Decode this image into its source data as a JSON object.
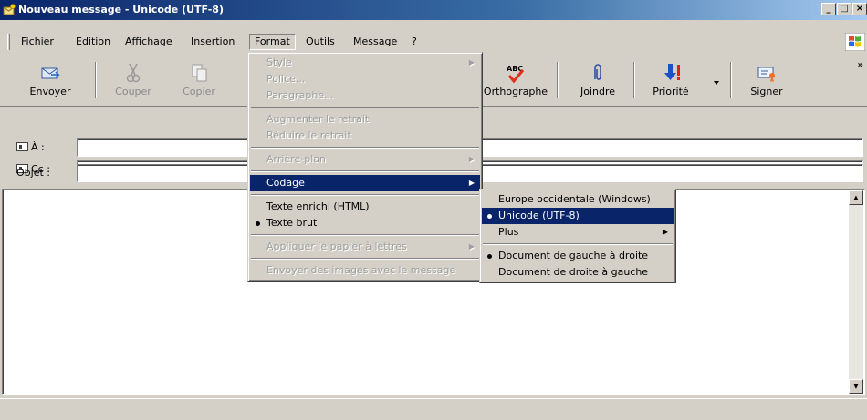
{
  "window": {
    "title": "Nouveau message - Unicode (UTF-8)",
    "controls": {
      "minimize": "_",
      "maximize": "□",
      "close": "×"
    }
  },
  "menubar": {
    "items": [
      "Fichier",
      "Edition",
      "Affichage",
      "Insertion",
      "Format",
      "Outils",
      "Message",
      "?"
    ],
    "open_item": "Format"
  },
  "toolbar": {
    "buttons": [
      {
        "label": "Envoyer",
        "icon": "send-icon",
        "enabled": true
      },
      {
        "label": "Couper",
        "icon": "scissors-icon",
        "enabled": false
      },
      {
        "label": "Copier",
        "icon": "copy-icon",
        "enabled": false
      },
      {
        "label": "Orthographe",
        "icon": "spellcheck-icon",
        "enabled": true
      },
      {
        "label": "Joindre",
        "icon": "paperclip-icon",
        "enabled": true
      },
      {
        "label": "Priorité",
        "icon": "priority-icon",
        "enabled": true
      },
      {
        "label": "Signer",
        "icon": "certificate-icon",
        "enabled": true
      }
    ],
    "more": "»"
  },
  "fields": {
    "to_label": "À :",
    "to_value": "",
    "cc_label": "Cc :",
    "cc_value": "",
    "subject_label": "Objet :",
    "subject_value": ""
  },
  "format_menu": {
    "items": [
      {
        "label": "Style",
        "disabled": true,
        "submenu": true
      },
      {
        "label": "Police...",
        "disabled": true
      },
      {
        "label": "Paragraphe...",
        "disabled": true
      },
      {
        "label": "Augmenter le retrait",
        "disabled": true
      },
      {
        "label": "Réduire le retrait",
        "disabled": true
      },
      {
        "label": "Arrière-plan",
        "disabled": true,
        "submenu": true
      },
      {
        "label": "Codage",
        "highlighted": true,
        "submenu": true
      },
      {
        "label": "Texte enrichi (HTML)"
      },
      {
        "label": "Texte brut",
        "checked": true
      },
      {
        "label": "Appliquer le papier à lettres",
        "disabled": true,
        "submenu": true
      },
      {
        "label": "Envoyer des images avec le message",
        "disabled": true
      }
    ]
  },
  "encoding_menu": {
    "items": [
      {
        "label": "Europe occidentale (Windows)"
      },
      {
        "label": "Unicode (UTF-8)",
        "checked": true,
        "highlighted": true
      },
      {
        "label": "Plus",
        "submenu": true
      },
      {
        "label": "Document de gauche à droite",
        "checked": true
      },
      {
        "label": "Document de droite à gauche"
      }
    ]
  },
  "colors": {
    "title_gradient_start": "#0a246a",
    "title_gradient_end": "#a6caf0",
    "face": "#d4d0c8",
    "highlight": "#0a246a"
  }
}
